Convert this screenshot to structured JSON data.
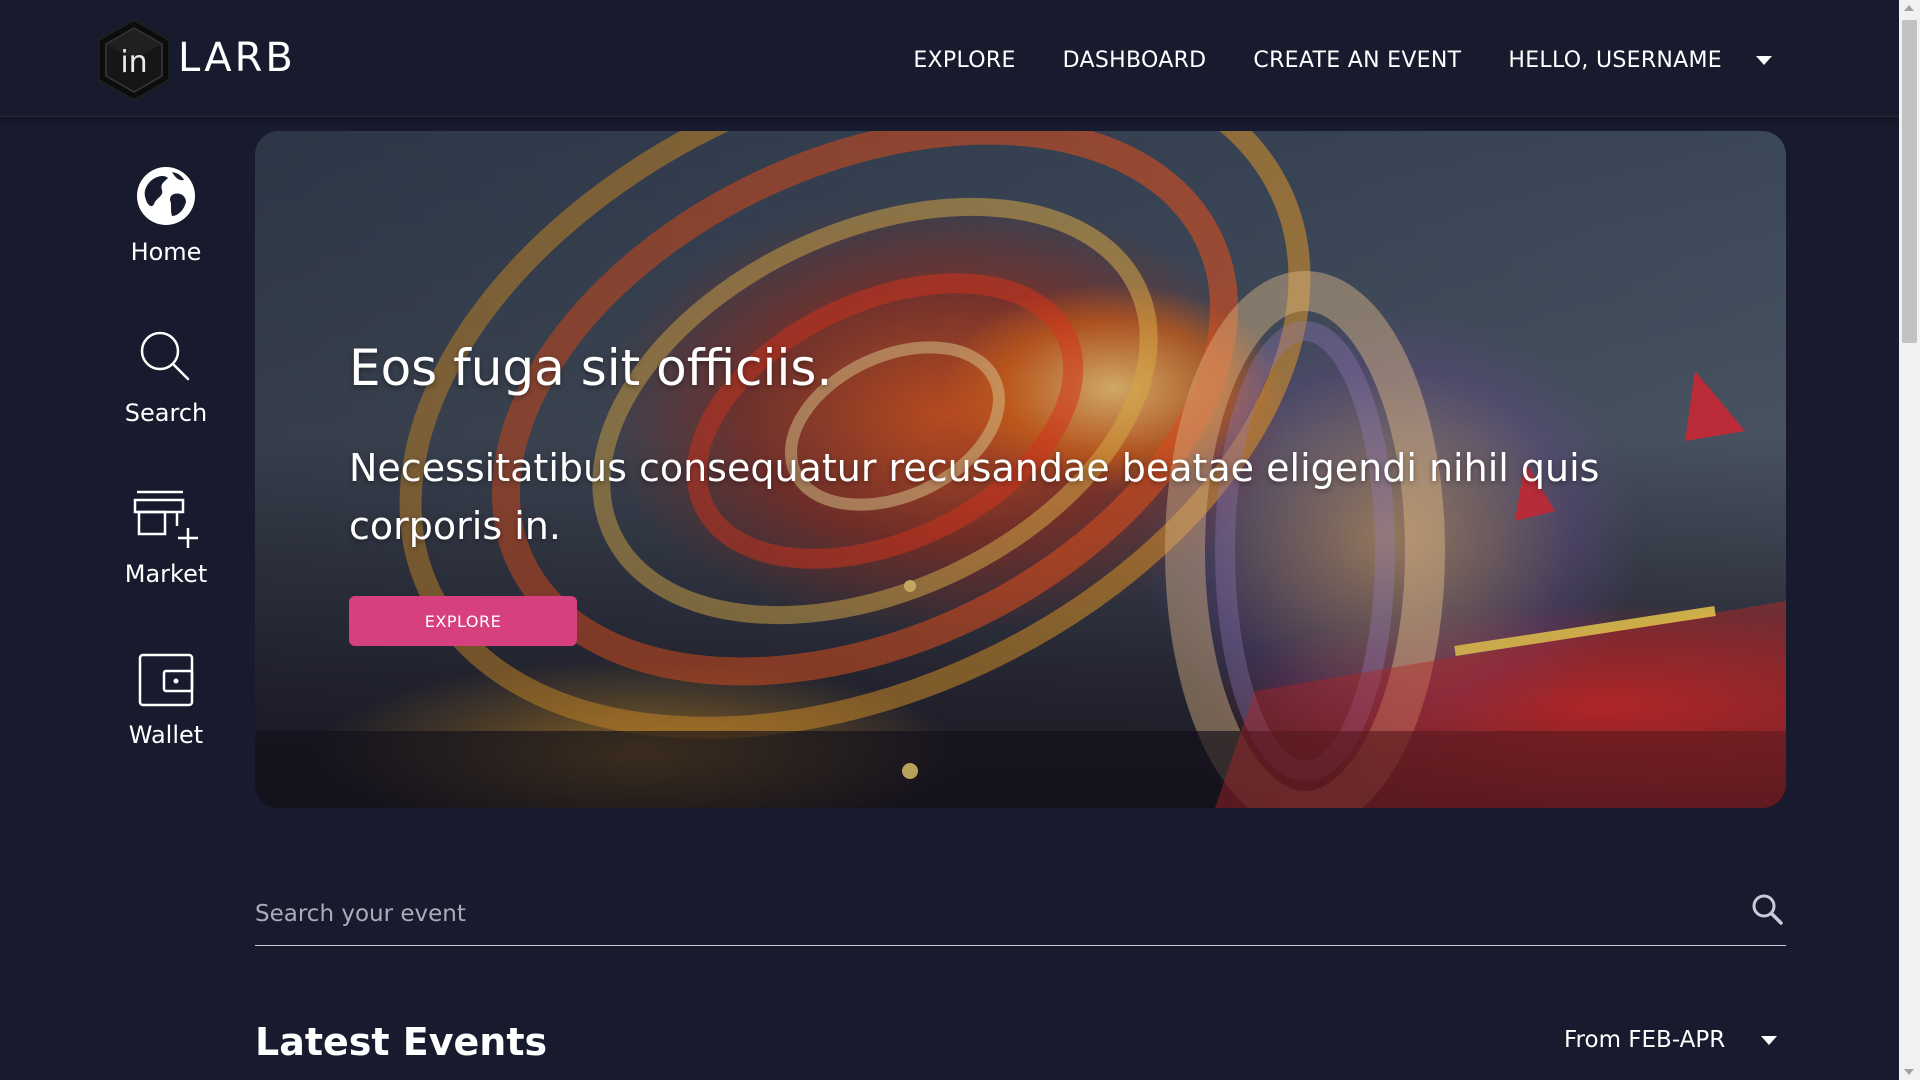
{
  "brand": {
    "logo_mark": "in",
    "name": "LARB"
  },
  "nav": {
    "items": [
      {
        "label": "EXPLORE"
      },
      {
        "label": "DASHBOARD"
      },
      {
        "label": "CREATE AN EVENT"
      }
    ],
    "user_label": "HELLO, USERNAME",
    "user_icon": "chevron-down-icon"
  },
  "sidebar": {
    "items": [
      {
        "label": "Home",
        "icon": "globe-icon"
      },
      {
        "label": "Search",
        "icon": "search-icon"
      },
      {
        "label": "Market",
        "icon": "market-add-icon"
      },
      {
        "label": "Wallet",
        "icon": "wallet-icon"
      }
    ]
  },
  "hero": {
    "title": "Eos fuga sit officiis.",
    "subtitle": "Necessitatibus consequatur recusandae beatae eligendi nihil quis corporis in.",
    "button_label": "EXPLORE",
    "accent": "#d6407e"
  },
  "search": {
    "placeholder": "Search your event",
    "icon": "search-icon"
  },
  "latest": {
    "title": "Latest Events",
    "filter_label": "From FEB-APR",
    "filter_icon": "chevron-down-icon"
  },
  "colors": {
    "background": "#171b2d",
    "text": "#ffffff",
    "accent": "#d6407e"
  }
}
